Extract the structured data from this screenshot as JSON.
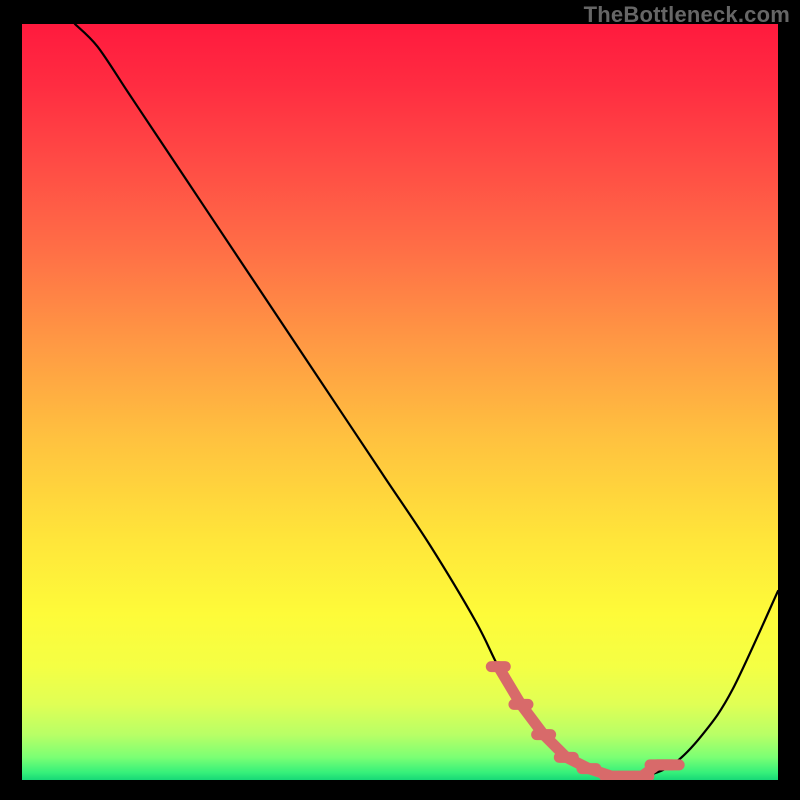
{
  "watermark": "TheBottleneck.com",
  "colors": {
    "frame": "#000000",
    "watermark": "#666666",
    "curve": "#000000",
    "marker": "#d86a6a",
    "background": "#000000"
  },
  "gradient_stops": [
    {
      "offset": 0.0,
      "color": "#ff1a3e"
    },
    {
      "offset": 0.08,
      "color": "#ff2c41"
    },
    {
      "offset": 0.18,
      "color": "#ff4a45"
    },
    {
      "offset": 0.3,
      "color": "#ff6f46"
    },
    {
      "offset": 0.42,
      "color": "#ff9844"
    },
    {
      "offset": 0.55,
      "color": "#ffc23f"
    },
    {
      "offset": 0.68,
      "color": "#ffe53a"
    },
    {
      "offset": 0.78,
      "color": "#fefb39"
    },
    {
      "offset": 0.85,
      "color": "#f4ff44"
    },
    {
      "offset": 0.9,
      "color": "#e0ff55"
    },
    {
      "offset": 0.94,
      "color": "#b8ff66"
    },
    {
      "offset": 0.97,
      "color": "#7bff74"
    },
    {
      "offset": 0.99,
      "color": "#36f07a"
    },
    {
      "offset": 1.0,
      "color": "#17d877"
    }
  ],
  "chart_data": {
    "type": "line",
    "title": "",
    "xlabel": "",
    "ylabel": "",
    "xlim": [
      0,
      100
    ],
    "ylim": [
      0,
      100
    ],
    "series": [
      {
        "name": "bottleneck-curve",
        "x": [
          7,
          10,
          14,
          18,
          24,
          30,
          36,
          42,
          48,
          54,
          60,
          63,
          66,
          70,
          74,
          78,
          82,
          86,
          90,
          94,
          100
        ],
        "y": [
          100,
          97,
          91,
          85,
          76,
          67,
          58,
          49,
          40,
          31,
          21,
          15,
          10,
          5,
          2,
          0.5,
          0.5,
          2,
          6,
          12,
          25
        ]
      }
    ],
    "markers": {
      "name": "floor-highlight",
      "x": [
        63,
        66,
        69,
        72,
        75,
        78,
        80,
        82,
        84,
        86
      ],
      "y": [
        15,
        10,
        6,
        3,
        1.5,
        0.5,
        0.5,
        0.5,
        2,
        2
      ]
    },
    "annotations": []
  }
}
